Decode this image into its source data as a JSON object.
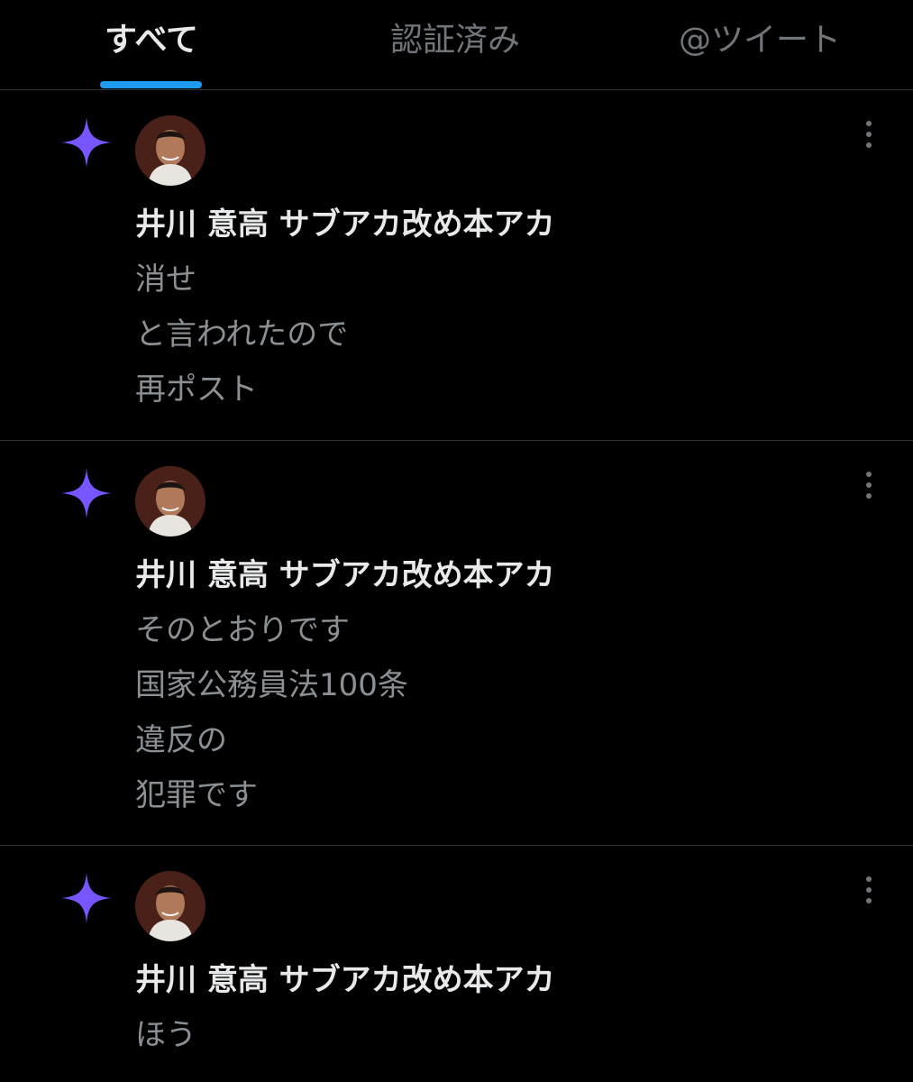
{
  "tabs": [
    {
      "label": "すべて",
      "active": true
    },
    {
      "label": "認証済み",
      "active": false
    },
    {
      "label": "@ツイート",
      "active": false
    }
  ],
  "colors": {
    "accent": "#1d9bf0",
    "spark": "#7856ff",
    "background": "#000000",
    "muted_text": "#8b9095"
  },
  "notifications": [
    {
      "icon": "sparkle-icon",
      "author": "井川 意高 サブアカ改め本アカ",
      "lines": [
        "消せ",
        "と言われたので",
        "再ポスト"
      ]
    },
    {
      "icon": "sparkle-icon",
      "author": "井川 意高 サブアカ改め本アカ",
      "lines": [
        "そのとおりです",
        "国家公務員法100条",
        "違反の",
        "犯罪です"
      ]
    },
    {
      "icon": "sparkle-icon",
      "author": "井川 意高 サブアカ改め本アカ",
      "lines": [
        "ほう"
      ]
    }
  ]
}
